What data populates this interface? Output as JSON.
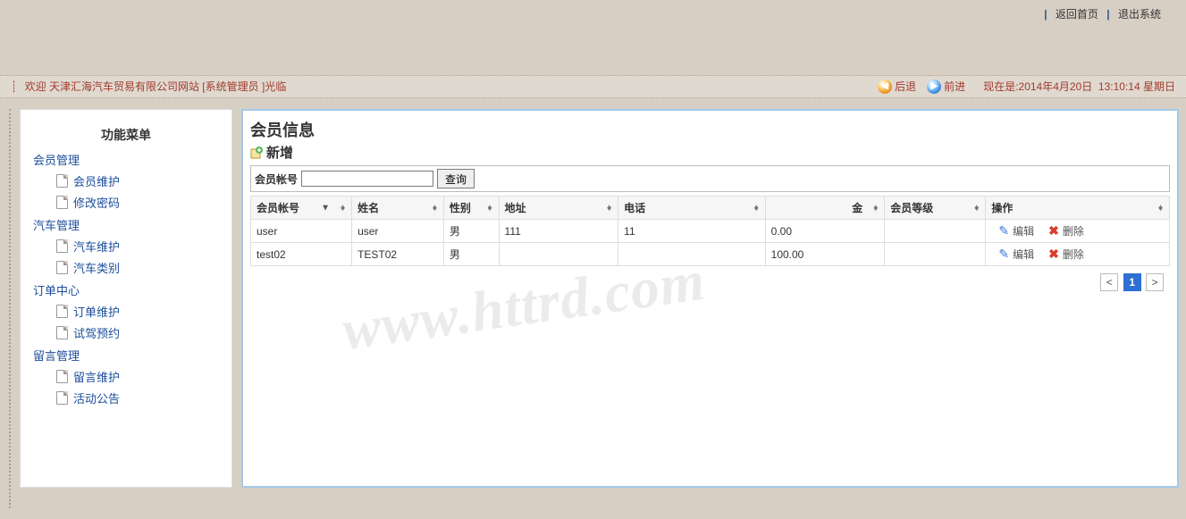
{
  "header": {
    "return_home": "返回首页",
    "logout": "退出系统"
  },
  "welcome": {
    "prefix": "欢迎",
    "site": "天津汇海汽车贸易有限公司网站",
    "role_open": "[",
    "role": "系统管理员",
    "role_close": "]",
    "suffix": "光临",
    "back": "后退",
    "forward": "前进",
    "now_label": "现在是:",
    "date": "2014年4月20日",
    "time": "13:10:14",
    "weekday": "星期日"
  },
  "sidebar": {
    "menu_title": "功能菜单",
    "groups": [
      {
        "label": "会员管理",
        "items": [
          "会员维护",
          "修改密码"
        ]
      },
      {
        "label": "汽车管理",
        "items": [
          "汽车维护",
          "汽车类别"
        ]
      },
      {
        "label": "订单中心",
        "items": [
          "订单维护",
          "试驾预约"
        ]
      },
      {
        "label": "留言管理",
        "items": [
          "留言维护",
          "活动公告"
        ]
      }
    ]
  },
  "content": {
    "title": "会员信息",
    "add_label": "新增",
    "search": {
      "label": "会员帐号",
      "placeholder": "",
      "button": "查询"
    },
    "columns": {
      "account": "会员帐号",
      "name": "姓名",
      "gender": "性别",
      "address": "地址",
      "phone": "电话",
      "amount": "",
      "amount_suffix": "金",
      "level": "会员等级",
      "action": "操作"
    },
    "rows": [
      {
        "account": "user",
        "name": "user",
        "gender": "男",
        "address": "111",
        "phone": "11",
        "amount": "0.00",
        "level": ""
      },
      {
        "account": "test02",
        "name": "TEST02",
        "gender": "男",
        "address": "",
        "phone": "",
        "amount": "100.00",
        "level": ""
      }
    ],
    "action_edit": "编辑",
    "action_delete": "删除",
    "pager": {
      "prev": "<",
      "current": "1",
      "next": ">"
    },
    "watermark": "www.httrd.com"
  }
}
